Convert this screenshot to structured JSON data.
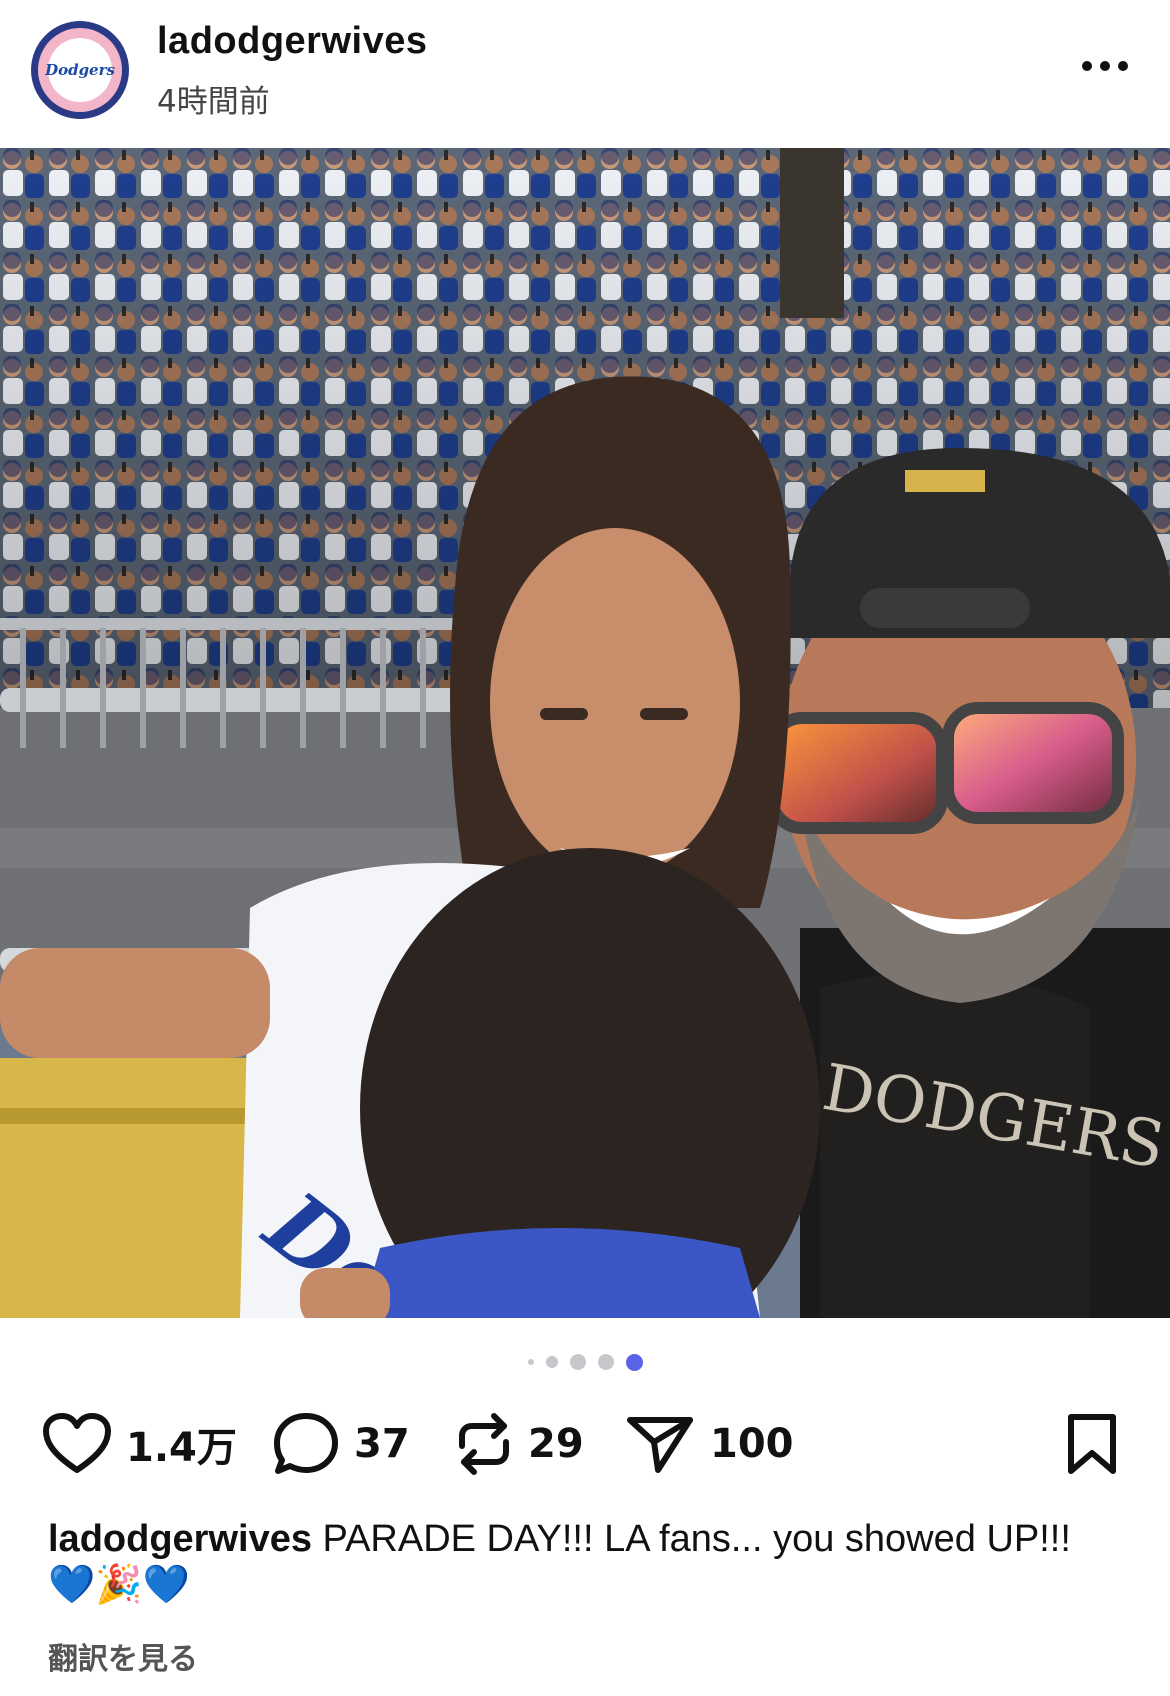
{
  "post": {
    "username": "ladodgerwives",
    "timestamp": "4時間前",
    "avatar_icon": "dodgers-wives-logo-icon",
    "avatar_text": "Dodgers"
  },
  "carousel": {
    "total": 5,
    "active_index": 4,
    "active_color": "#5b63e8",
    "inactive_color": "#c6c8cc"
  },
  "actions": {
    "likes": "1.4万",
    "comments": "37",
    "reposts": "29",
    "shares": "100"
  },
  "caption": {
    "username": "ladodgerwives",
    "text": "PARADE DAY!!! LA fans... you showed UP!!! 💙🎉💙"
  },
  "translate_label": "翻訳を見る"
}
